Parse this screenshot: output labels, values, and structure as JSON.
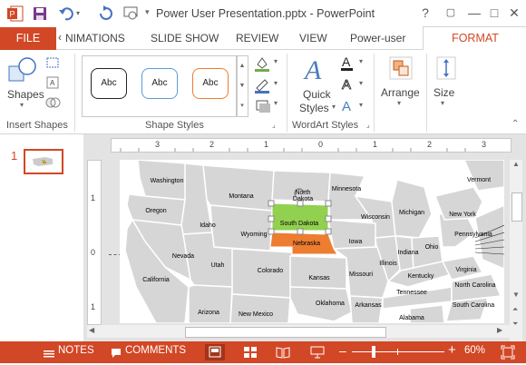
{
  "app": {
    "title": "Power User Presentation.pptx - PowerPoint",
    "window_controls": [
      "?",
      "▢",
      "—",
      "□",
      "✕"
    ]
  },
  "tabs": {
    "file": "FILE",
    "items": [
      "NIMATIONS",
      "SLIDE SHOW",
      "REVIEW",
      "VIEW",
      "Power-user"
    ],
    "active": "FORMAT"
  },
  "ribbon": {
    "insert_shapes": {
      "label": "Insert Shapes",
      "shapes_btn": "Shapes"
    },
    "shape_styles": {
      "label": "Shape Styles",
      "samples": [
        "Abc",
        "Abc",
        "Abc"
      ],
      "colors": [
        "#222222",
        "#5b9bd5",
        "#ed7d31"
      ]
    },
    "wordart": {
      "label": "WordArt Styles",
      "quick_styles_1": "Quick",
      "quick_styles_2": "Styles"
    },
    "arrange": {
      "label": "Arrange"
    },
    "size": {
      "label": "Size"
    }
  },
  "thumbs": {
    "slide_number": "1"
  },
  "ruler": {
    "h_marks": [
      "3",
      "2",
      "1",
      "0",
      "1",
      "2",
      "3"
    ],
    "v_marks": [
      "1",
      "0"
    ]
  },
  "map": {
    "selected_state": "South Dakota",
    "highlighted_state": "Nebraska",
    "states": [
      "Washington",
      "Oregon",
      "Idaho",
      "Montana",
      "Wyoming",
      "Nevada",
      "California",
      "Utah",
      "Colorado",
      "Arizona",
      "New Mexico",
      "North",
      "Dakota",
      "Minnesota",
      "Wisconsin",
      "Iowa",
      "Michigan",
      "Illinois",
      "Indiana",
      "Ohio",
      "Kansas",
      "Missouri",
      "Kentucky",
      "Oklahoma",
      "Arkansas",
      "Tennessee",
      "Alabama",
      "Pennsylvania",
      "New York",
      "Vermont",
      "Virginia",
      "North Carolina",
      "South Carolina"
    ]
  },
  "statusbar": {
    "notes": "NOTES",
    "comments": "COMMENTS",
    "zoom": "60%",
    "minus": "–",
    "plus": "+"
  }
}
